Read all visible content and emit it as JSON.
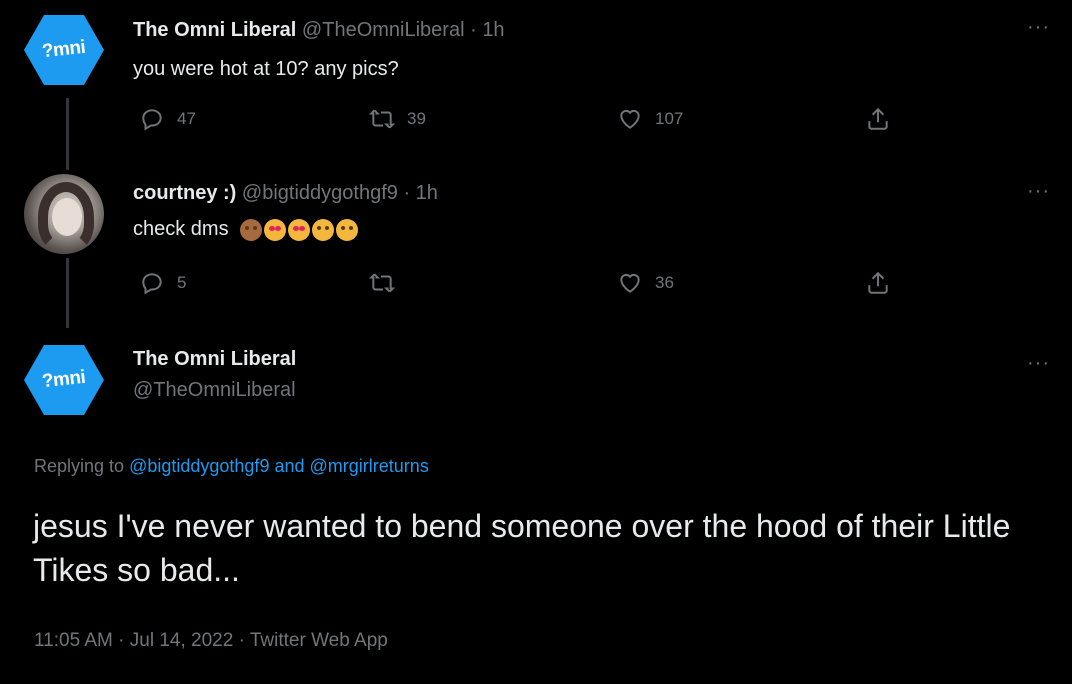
{
  "tweets": [
    {
      "avatar_text": "?mni",
      "name": "The Omni Liberal",
      "handle": "@TheOmniLiberal",
      "time": "1h",
      "text": "you were hot at 10? any pics?",
      "replies": "47",
      "retweets": "39",
      "likes": "107"
    },
    {
      "name": "courtney :)",
      "handle": "@bigtiddygothgf9",
      "time": "1h",
      "text": "check dms",
      "replies": "5",
      "retweets": "",
      "likes": "36"
    }
  ],
  "main_tweet": {
    "avatar_text": "?mni",
    "name": "The Omni Liberal",
    "handle": "@TheOmniLiberal",
    "replying_prefix": "Replying to",
    "replying_user1": "@bigtiddygothgf9",
    "replying_and": "and",
    "replying_user2": "@mrgirlreturns",
    "text": "jesus I've never wanted to bend someone over the hood of their Little Tikes so bad...",
    "time": "11:05 AM",
    "date": "Jul 14, 2022",
    "source": "Twitter Web App"
  },
  "ui": {
    "more_label": "···",
    "separator": "·"
  },
  "colors": {
    "background": "#000000",
    "text": "#e7e9ea",
    "muted": "#71767b",
    "accent": "#1d9bf0",
    "line": "#333639"
  }
}
